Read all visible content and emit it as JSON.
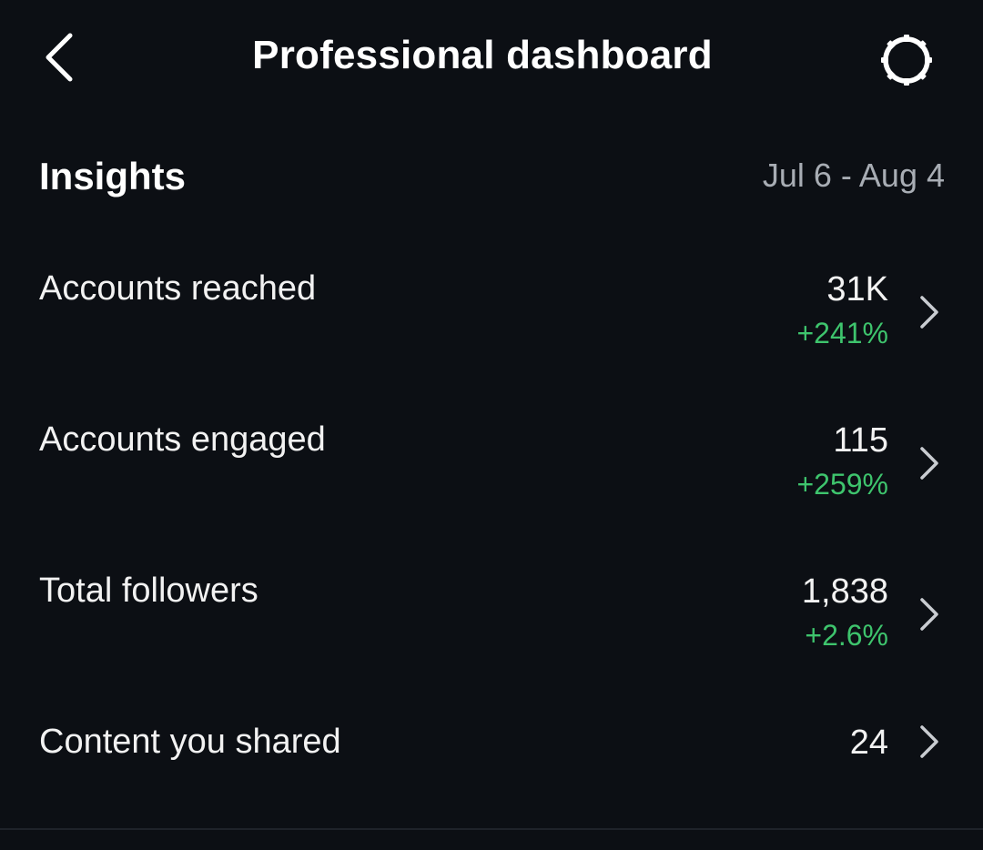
{
  "header": {
    "title": "Professional dashboard",
    "back_icon": "back-arrow-icon",
    "settings_icon": "gear-icon"
  },
  "insights": {
    "title": "Insights",
    "date_range": "Jul 6 - Aug 4",
    "rows": [
      {
        "label": "Accounts reached",
        "value": "31K",
        "change": "+241%"
      },
      {
        "label": "Accounts engaged",
        "value": "115",
        "change": "+259%"
      },
      {
        "label": "Total followers",
        "value": "1,838",
        "change": "+2.6%"
      },
      {
        "label": "Content you shared",
        "value": "24",
        "change": ""
      }
    ]
  },
  "colors": {
    "background": "#0c0f14",
    "text": "#f2f2f2",
    "muted": "#a8adb4",
    "positive": "#3ec46d"
  }
}
